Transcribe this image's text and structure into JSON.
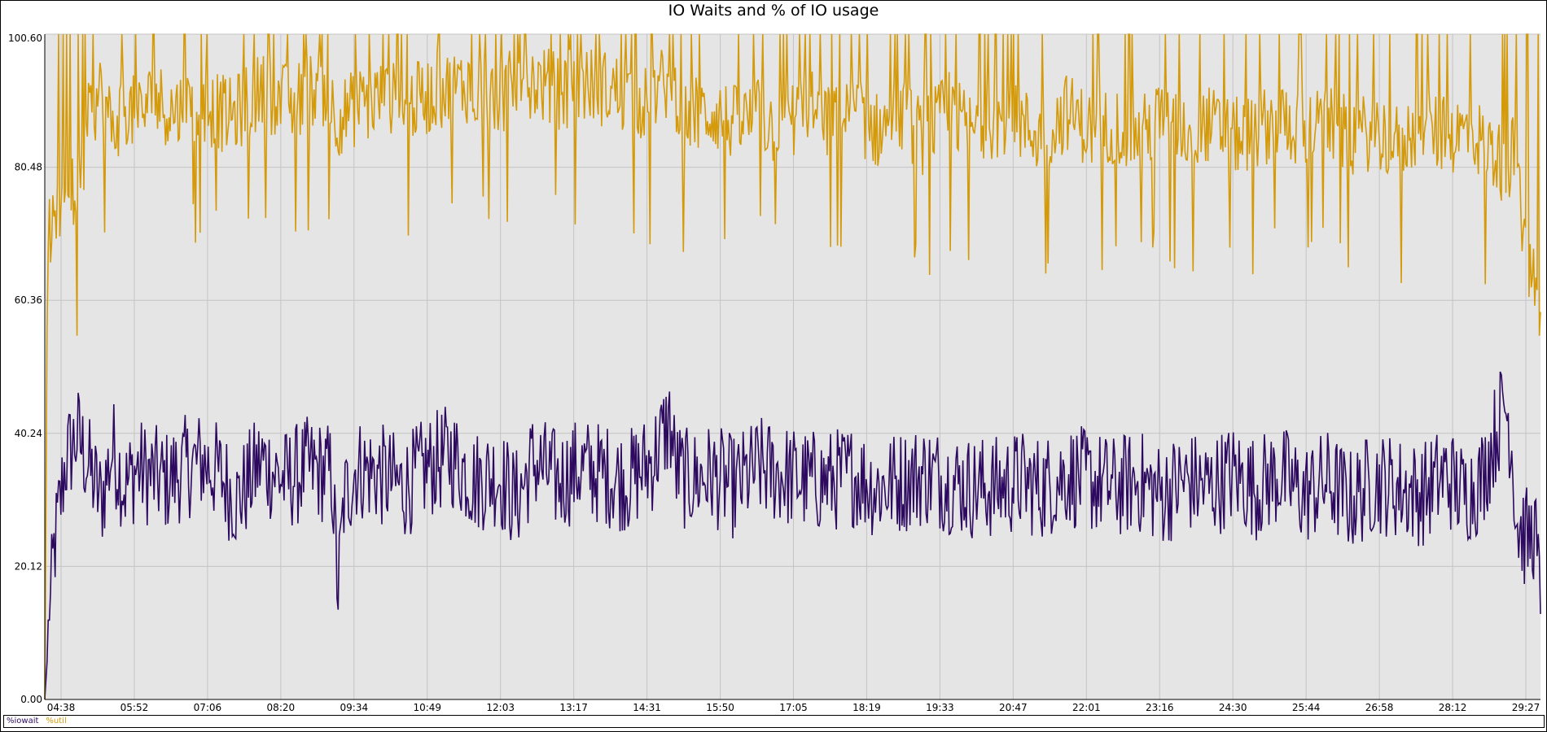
{
  "chart_data": {
    "type": "line",
    "title": "IO Waits and % of IO usage",
    "xlabel": "",
    "ylabel": "",
    "x_ticks": [
      "04:38",
      "05:52",
      "07:06",
      "08:20",
      "09:34",
      "10:49",
      "12:03",
      "13:17",
      "14:31",
      "15:50",
      "17:05",
      "18:19",
      "19:33",
      "20:47",
      "22:01",
      "23:16",
      "24:30",
      "25:44",
      "26:58",
      "28:12",
      "29:27"
    ],
    "y_ticks": [
      "0.00",
      "20.12",
      "40.24",
      "60.36",
      "80.48",
      "100.60"
    ],
    "ylim": [
      0,
      100.6
    ],
    "x_range_minutes": [
      4.35,
      29.6
    ],
    "grid": true,
    "legend_position": "bottom-left",
    "series": [
      {
        "name": "%iowait",
        "color": "#2d0a60",
        "x_minutes": [
          4.35,
          4.5,
          4.7,
          4.9,
          5.1,
          5.3,
          5.5,
          5.7,
          5.9,
          6.1,
          6.4,
          6.7,
          7.0,
          7.3,
          7.6,
          8.0,
          8.4,
          8.8,
          9.2,
          9.3,
          9.4,
          9.6,
          10.0,
          10.4,
          10.8,
          11.2,
          11.6,
          12.0,
          12.3,
          12.6,
          13.0,
          13.4,
          13.8,
          14.2,
          14.6,
          14.9,
          15.0,
          15.2,
          15.6,
          16.0,
          16.4,
          16.8,
          17.2,
          17.6,
          18.0,
          18.4,
          18.8,
          19.2,
          19.6,
          20.0,
          20.4,
          20.8,
          21.2,
          21.6,
          22.0,
          22.4,
          22.8,
          23.2,
          23.6,
          24.0,
          24.4,
          24.8,
          25.2,
          25.6,
          26.0,
          26.4,
          26.8,
          27.2,
          27.6,
          28.0,
          28.3,
          28.6,
          28.8,
          29.0,
          29.1,
          29.2,
          29.3,
          29.4,
          29.5,
          29.6
        ],
        "values": [
          0,
          22,
          36,
          40,
          35,
          30,
          38,
          32,
          35,
          34,
          33,
          35,
          36,
          34,
          30,
          36,
          33,
          35,
          34,
          16,
          30,
          35,
          34,
          32,
          35,
          37,
          33,
          34,
          30,
          36,
          33,
          35,
          34,
          33,
          36,
          42,
          35,
          33,
          34,
          32,
          35,
          34,
          33,
          33,
          34,
          32,
          33,
          34,
          33,
          32,
          32,
          33,
          32,
          34,
          33,
          32,
          33,
          31,
          33,
          32,
          34,
          32,
          34,
          31,
          33,
          30,
          33,
          32,
          31,
          34,
          31,
          33,
          39,
          45,
          40,
          27,
          25,
          24,
          26,
          14
        ]
      },
      {
        "name": "%util",
        "color": "#d49a0a",
        "x_minutes": [
          4.35,
          4.4,
          4.5,
          4.7,
          4.9,
          5.1,
          5.3,
          5.5,
          5.7,
          5.9,
          6.2,
          6.5,
          7.0,
          7.5,
          8.0,
          8.5,
          9.0,
          9.3,
          9.5,
          10.0,
          10.5,
          11.0,
          11.5,
          12.0,
          12.5,
          13.0,
          13.5,
          14.0,
          14.5,
          14.9,
          15.2,
          15.6,
          16.0,
          16.4,
          16.8,
          17.2,
          17.6,
          18.0,
          18.4,
          18.8,
          19.2,
          19.6,
          20.0,
          20.4,
          20.8,
          21.2,
          21.6,
          22.0,
          22.4,
          22.8,
          23.2,
          23.6,
          24.0,
          24.4,
          24.8,
          25.2,
          25.6,
          26.0,
          26.4,
          26.8,
          27.2,
          27.6,
          28.0,
          28.4,
          28.8,
          29.0,
          29.2,
          29.35,
          29.5,
          29.6
        ],
        "values": [
          0,
          72,
          70,
          78,
          75,
          88,
          92,
          86,
          90,
          88,
          91,
          89,
          90,
          88,
          92,
          90,
          93,
          88,
          89,
          91,
          90,
          92,
          93,
          91,
          94,
          92,
          93,
          92,
          90,
          94,
          88,
          89,
          87,
          88,
          86,
          90,
          87,
          89,
          86,
          88,
          85,
          89,
          86,
          88,
          87,
          85,
          89,
          86,
          87,
          85,
          88,
          86,
          87,
          85,
          86,
          88,
          86,
          87,
          85,
          86,
          84,
          87,
          85,
          86,
          83,
          80,
          84,
          66,
          62,
          60
        ]
      }
    ]
  }
}
